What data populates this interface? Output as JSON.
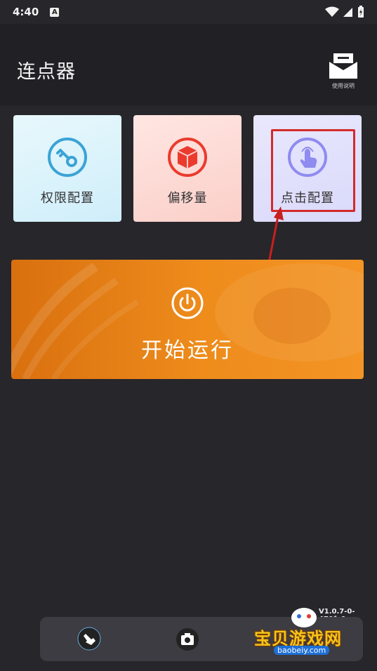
{
  "status_bar": {
    "time": "4:40",
    "notification_badge": "A"
  },
  "header": {
    "title": "连点器",
    "manual_label": "使用说明"
  },
  "cards": [
    {
      "label": "权限配置",
      "icon": "key-icon",
      "color": "#3ba3d6"
    },
    {
      "label": "偏移量",
      "icon": "cube-icon",
      "color": "#ea3b2e"
    },
    {
      "label": "点击配置",
      "icon": "tap-icon",
      "color": "#8f8bf0"
    }
  ],
  "start_button": {
    "label": "开始运行",
    "icon": "power-icon"
  },
  "version": "V1.0.7-0-470fe1",
  "bottom_bar": {
    "items": [
      "touch-icon",
      "camera-icon"
    ]
  },
  "watermark": {
    "text": "宝贝游戏网",
    "url": "baobeiy.com"
  },
  "colors": {
    "background": "#27262b",
    "header": "#212024",
    "accent_orange": "#ee8c1c",
    "highlight_red": "#d42a2a"
  }
}
